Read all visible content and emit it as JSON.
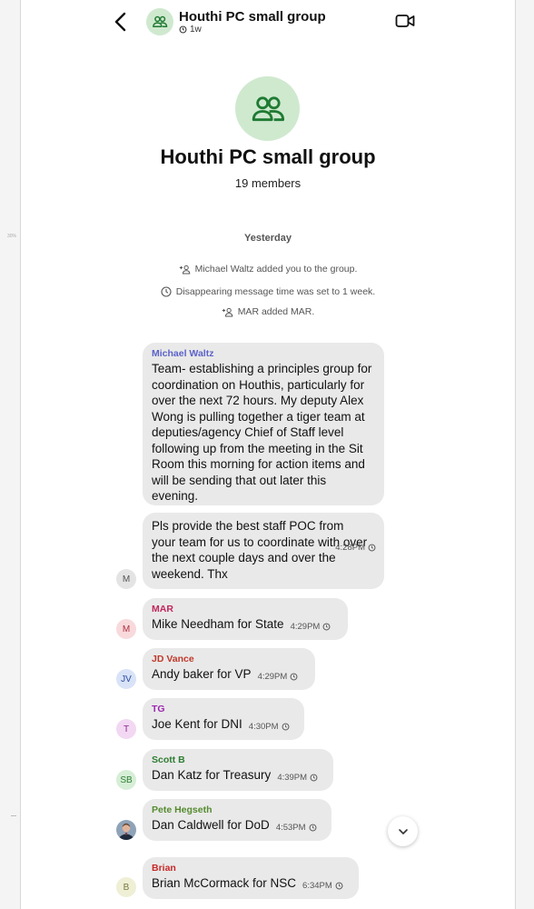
{
  "header": {
    "title": "Houthi PC small group",
    "timer": "1w"
  },
  "group": {
    "name": "Houthi PC small group",
    "members": "19 members"
  },
  "day_label": "Yesterday",
  "system_messages": [
    "Michael Waltz added you to the group.",
    "Disappearing message time was set to 1 week.",
    "MAR added MAR."
  ],
  "messages": [
    {
      "sender": "Michael Waltz",
      "sender_color": "#5b62c9",
      "text": "Team- establishing a principles group for coordination on Houthis, particularly for over the next 72 hours. My deputy Alex Wong is pulling together a tiger team at deputies/agency Chief of Staff level following up from the meeting in the Sit Room this morning for action items and will be sending that out later this evening."
    },
    {
      "text": "Pls provide the best staff POC from your team for us to coordinate with over the next couple days and over the weekend. Thx",
      "time": "4:28PM",
      "avatar": "M",
      "avatar_bg": "#e4e4e4",
      "avatar_fg": "#555"
    },
    {
      "sender": "MAR",
      "sender_color": "#c2255c",
      "text": "Mike Needham for State",
      "time": "4:29PM",
      "avatar": "M",
      "avatar_bg": "#f8d9dc",
      "avatar_fg": "#b03040"
    },
    {
      "sender": "JD Vance",
      "sender_color": "#c0392b",
      "text": "Andy baker for VP",
      "time": "4:29PM",
      "avatar": "JV",
      "avatar_bg": "#d9e3f7",
      "avatar_fg": "#2a4aa0"
    },
    {
      "sender": "TG",
      "sender_color": "#9c27b0",
      "text": "Joe Kent for DNI",
      "time": "4:30PM",
      "avatar": "T",
      "avatar_bg": "#f2d8f2",
      "avatar_fg": "#8e2a90"
    },
    {
      "sender": "Scott B",
      "sender_color": "#2e7d32",
      "text": "Dan Katz for Treasury",
      "time": "4:39PM",
      "avatar": "SB",
      "avatar_bg": "#d6eed6",
      "avatar_fg": "#2e7d32"
    },
    {
      "sender": "Pete Hegseth",
      "sender_color": "#558b2f",
      "text": "Dan Caldwell for DoD",
      "time": "4:53PM",
      "avatar": "photo"
    },
    {
      "sender": "Brian",
      "sender_color": "#c62828",
      "text": "Brian McCormack for NSC",
      "time": "6:34PM",
      "avatar": "B",
      "avatar_bg": "#efefd6",
      "avatar_fg": "#777740"
    }
  ],
  "icons": [
    "back-icon",
    "group-icon",
    "timer-icon",
    "video-call-icon",
    "add-person-icon",
    "clock-icon",
    "chevron-down-icon"
  ]
}
